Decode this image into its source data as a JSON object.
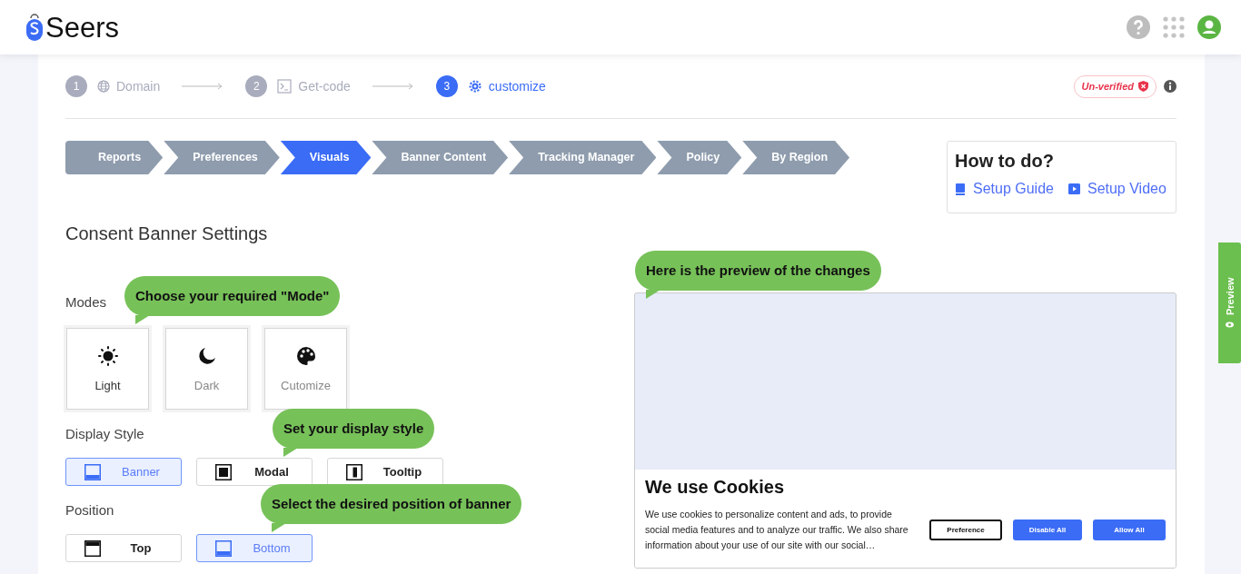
{
  "header": {
    "brand": "Seers"
  },
  "steps": [
    {
      "number": "1",
      "label": "Domain",
      "kind": "globe",
      "selected": false
    },
    {
      "number": "2",
      "label": "Get-code",
      "kind": "terminal",
      "selected": false
    },
    {
      "number": "3",
      "label": "customize",
      "kind": "gear",
      "selected": true
    }
  ],
  "verification": {
    "label": "Un-verified"
  },
  "tabs": [
    {
      "label": "Reports",
      "selected": false
    },
    {
      "label": "Preferences",
      "selected": false
    },
    {
      "label": "Visuals",
      "selected": true
    },
    {
      "label": "Banner Content",
      "selected": false
    },
    {
      "label": "Tracking Manager",
      "selected": false
    },
    {
      "label": "Policy",
      "selected": false
    },
    {
      "label": "By Region",
      "selected": false
    }
  ],
  "how_to": {
    "title": "How to do?",
    "links": [
      {
        "label": "Setup Guide",
        "kind": "book"
      },
      {
        "label": "Setup Video",
        "kind": "video"
      }
    ]
  },
  "section_title": "Consent Banner Settings",
  "modes": {
    "label": "Modes",
    "hint": "Choose your required \"Mode\"",
    "options": [
      {
        "label": "Light",
        "kind": "sun",
        "selected": true
      },
      {
        "label": "Dark",
        "kind": "moon",
        "selected": false
      },
      {
        "label": "Cutomize",
        "kind": "palette",
        "selected": false
      }
    ]
  },
  "display_style": {
    "label": "Display Style",
    "hint": "Set your display style",
    "options": [
      {
        "label": "Banner",
        "kind": "banner",
        "selected": true
      },
      {
        "label": "Modal",
        "kind": "modal",
        "selected": false
      },
      {
        "label": "Tooltip",
        "kind": "tooltip",
        "selected": false
      }
    ]
  },
  "position": {
    "label": "Position",
    "hint": "Select the desired position of banner",
    "options": [
      {
        "label": "Top",
        "kind": "top",
        "selected": false
      },
      {
        "label": "Bottom",
        "kind": "bottom",
        "selected": true
      }
    ]
  },
  "preview": {
    "hint": "Here is the preview of the changes",
    "banner": {
      "title": "We use Cookies",
      "text": "We use cookies to personalize content and ads, to provide social media features and to analyze our traffic. We also share information about your use of our site with our social…",
      "buttons": [
        {
          "label": "Preference",
          "kind": "outline"
        },
        {
          "label": "Disable All",
          "kind": "solid"
        },
        {
          "label": "Allow All",
          "kind": "solid"
        }
      ]
    }
  },
  "preview_tab": {
    "label": "Preview"
  }
}
